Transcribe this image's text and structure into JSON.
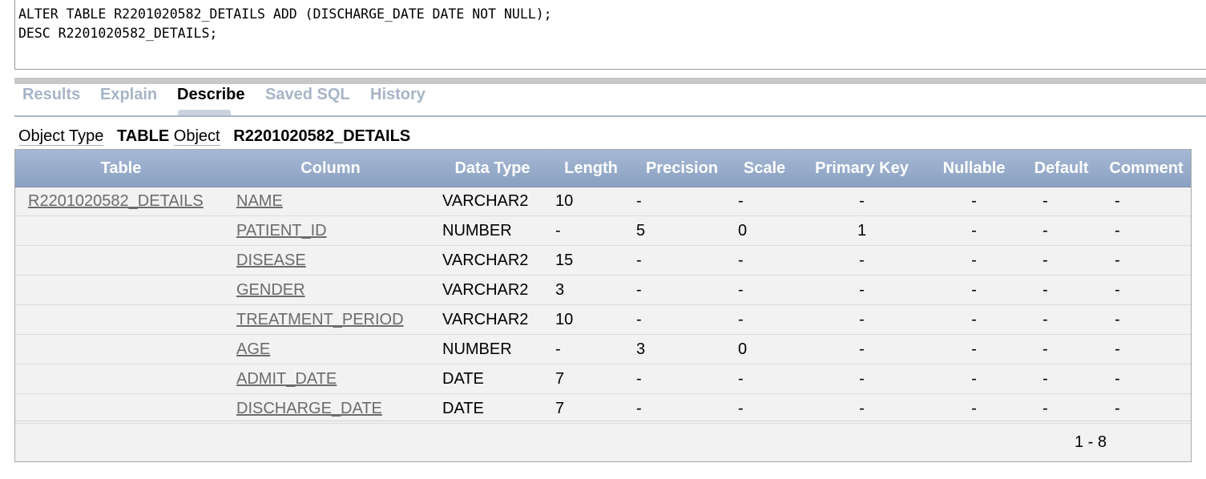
{
  "editor": {
    "sql": "ALTER TABLE R2201020582_DETAILS ADD (DISCHARGE_DATE DATE NOT NULL);\nDESC R2201020582_DETAILS;"
  },
  "tabs": [
    {
      "label": "Results",
      "active": false
    },
    {
      "label": "Explain",
      "active": false
    },
    {
      "label": "Describe",
      "active": true
    },
    {
      "label": "Saved SQL",
      "active": false
    },
    {
      "label": "History",
      "active": false
    }
  ],
  "object_info": {
    "type_label": "Object Type",
    "type_value": "TABLE",
    "object_label": "Object",
    "object_value": "R2201020582_DETAILS"
  },
  "table": {
    "headers": [
      "Table",
      "Column",
      "Data Type",
      "Length",
      "Precision",
      "Scale",
      "Primary Key",
      "Nullable",
      "Default",
      "Comment"
    ],
    "rows": [
      [
        "R2201020582_DETAILS",
        "NAME",
        "VARCHAR2",
        "10",
        "-",
        "-",
        "-",
        "-",
        "-",
        "-"
      ],
      [
        "",
        "PATIENT_ID",
        "NUMBER",
        "-",
        "5",
        "0",
        "1",
        "-",
        "-",
        "-"
      ],
      [
        "",
        "DISEASE",
        "VARCHAR2",
        "15",
        "-",
        "-",
        "-",
        "-",
        "-",
        "-"
      ],
      [
        "",
        "GENDER",
        "VARCHAR2",
        "3",
        "-",
        "-",
        "-",
        "-",
        "-",
        "-"
      ],
      [
        "",
        "TREATMENT_PERIOD",
        "VARCHAR2",
        "10",
        "-",
        "-",
        "-",
        "-",
        "-",
        "-"
      ],
      [
        "",
        "AGE",
        "NUMBER",
        "-",
        "3",
        "0",
        "-",
        "-",
        "-",
        "-"
      ],
      [
        "",
        "ADMIT_DATE",
        "DATE",
        "7",
        "-",
        "-",
        "-",
        "-",
        "-",
        "-"
      ],
      [
        "",
        "DISCHARGE_DATE",
        "DATE",
        "7",
        "-",
        "-",
        "-",
        "-",
        "-",
        "-"
      ]
    ],
    "pagination": "1 - 8"
  },
  "colors": {
    "header_bg": "#8ba1c2",
    "inactive_tab": "#a6b4c7",
    "row_bg": "#f2f2f2"
  }
}
